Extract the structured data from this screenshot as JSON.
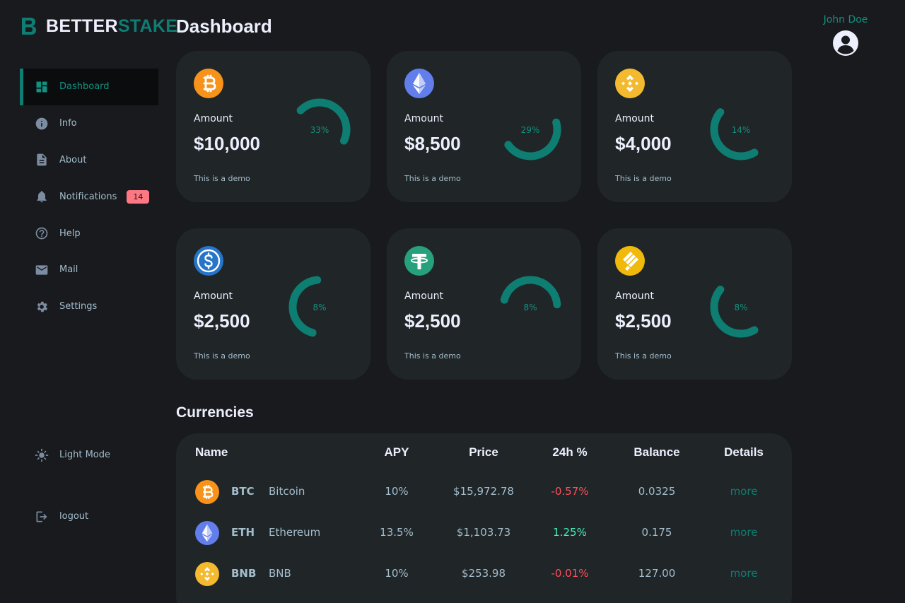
{
  "brand": {
    "part1": "BETTER",
    "part2": "STAKE"
  },
  "page_title": "Dashboard",
  "user": {
    "name": "John Doe"
  },
  "nav": [
    {
      "label": "Dashboard",
      "icon": "dashboard-icon",
      "active": true
    },
    {
      "label": "Info",
      "icon": "info-icon"
    },
    {
      "label": "About",
      "icon": "document-icon"
    },
    {
      "label": "Notifications",
      "icon": "bell-icon",
      "badge": "14"
    },
    {
      "label": "Help",
      "icon": "help-icon"
    },
    {
      "label": "Mail",
      "icon": "mail-icon"
    },
    {
      "label": "Settings",
      "icon": "gear-icon"
    }
  ],
  "nav_bottom": {
    "light_mode": "Light Mode",
    "logout": "logout"
  },
  "cards": [
    {
      "coin": "bitcoin-icon",
      "label": "Amount",
      "amount": "$10,000",
      "percent_label": "33%",
      "percent": 33,
      "note": "This is a demo"
    },
    {
      "coin": "ethereum-icon",
      "label": "Amount",
      "amount": "$8,500",
      "percent_label": "29%",
      "percent": 29,
      "note": "This is a demo"
    },
    {
      "coin": "bnb-icon",
      "label": "Amount",
      "amount": "$4,000",
      "percent_label": "14%",
      "percent": 14,
      "note": "This is a demo"
    },
    {
      "coin": "usdc-icon",
      "label": "Amount",
      "amount": "$2,500",
      "percent_label": "8%",
      "percent": 8,
      "note": "This is a demo"
    },
    {
      "coin": "tether-icon",
      "label": "Amount",
      "amount": "$2,500",
      "percent_label": "8%",
      "percent": 8,
      "note": "This is a demo"
    },
    {
      "coin": "busd-icon",
      "label": "Amount",
      "amount": "$2,500",
      "percent_label": "8%",
      "percent": 8,
      "note": "This is a demo"
    }
  ],
  "currencies": {
    "title": "Currencies",
    "headers": {
      "name": "Name",
      "apy": "APY",
      "price": "Price",
      "change": "24h %",
      "balance": "Balance",
      "details": "Details"
    },
    "rows": [
      {
        "icon": "bitcoin-icon",
        "symbol": "BTC",
        "name": "Bitcoin",
        "apy": "10%",
        "price": "$15,972.78",
        "change": "-0.57%",
        "trend": "down",
        "balance": "0.0325",
        "details": "more"
      },
      {
        "icon": "ethereum-icon",
        "symbol": "ETH",
        "name": "Ethereum",
        "apy": "13.5%",
        "price": "$1,103.73",
        "change": "1.25%",
        "trend": "up",
        "balance": "0.175",
        "details": "more"
      },
      {
        "icon": "bnb-icon",
        "symbol": "BNB",
        "name": "BNB",
        "apy": "10%",
        "price": "$253.98",
        "change": "-0.01%",
        "trend": "down",
        "balance": "127.00",
        "details": "more"
      }
    ]
  },
  "colors": {
    "background": "#181a1e",
    "card": "#202528",
    "accent": "#0e7d72",
    "danger": "#ff4f5e",
    "success": "#41f1b6",
    "badge": "#ff7782"
  }
}
